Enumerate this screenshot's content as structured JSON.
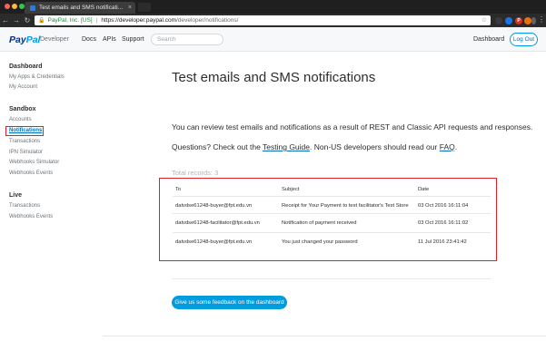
{
  "browser": {
    "tab_title": "Test emails and SMS notificati...",
    "tab_close": "×",
    "nav": {
      "back": "←",
      "forward": "→",
      "reload": "↻"
    },
    "site_identity": "PayPal, Inc. [US]",
    "url_host": "https://developer.paypal.com",
    "url_path": "/developer/notifications/",
    "star": "☆",
    "menu": "⋮",
    "extensions": [
      {
        "label": "",
        "color": "#3b3b3b"
      },
      {
        "label": "",
        "color": "#1a73e8"
      },
      {
        "label": "P",
        "color": "#d93025"
      },
      {
        "label": "",
        "color": "#e8710a"
      },
      {
        "label": "",
        "color": "#5f6368"
      }
    ]
  },
  "header": {
    "logo_pay": "Pay",
    "logo_pal": "Pal",
    "logo_sub": "Developer",
    "nav": [
      "Docs",
      "APIs",
      "Support"
    ],
    "search_placeholder": "Search",
    "dashboard": "Dashboard",
    "logout": "Log Out"
  },
  "sidebar": {
    "dashboard_heading": "Dashboard",
    "dashboard_items": [
      "My Apps & Credentials",
      "My Account"
    ],
    "sandbox_heading": "Sandbox",
    "sandbox_items": [
      "Accounts",
      "Notifications",
      "Transactions",
      "IPN Simulator",
      "Webhooks Simulator",
      "Webhooks Events"
    ],
    "live_heading": "Live",
    "live_items": [
      "Transactions",
      "Webhooks Events"
    ]
  },
  "main": {
    "title": "Test emails and SMS notifications",
    "intro": "You can review test emails and notifications as a result of REST and Classic API requests and responses.",
    "questions_pre": "Questions? Check out the ",
    "testing_guide": "Testing Guide",
    "questions_mid": ". Non-US developers should read our ",
    "faq": "FAQ",
    "questions_end": ".",
    "total_records": "Total records: 3",
    "columns": [
      "To",
      "Subject",
      "Date"
    ],
    "rows": [
      [
        "datvdse61248-buyer@fpt.edu.vn",
        "Receipt for Your Payment to test facilitator's Test Store",
        "03 Oct 2016 16:11:04"
      ],
      [
        "datvdse61248-facilitator@fpt.edu.vn",
        "Notification of payment received",
        "03 Oct 2016 16:11:02"
      ],
      [
        "datvdse61248-buyer@fpt.edu.vn",
        "You just changed your password",
        "11 Jul 2016 23:41:42"
      ]
    ],
    "feedback_button": "Give us some feedback on the dashboard"
  },
  "colors": {
    "brand_dark": "#003087",
    "brand_light": "#009cde",
    "highlight": "#e0202a"
  }
}
